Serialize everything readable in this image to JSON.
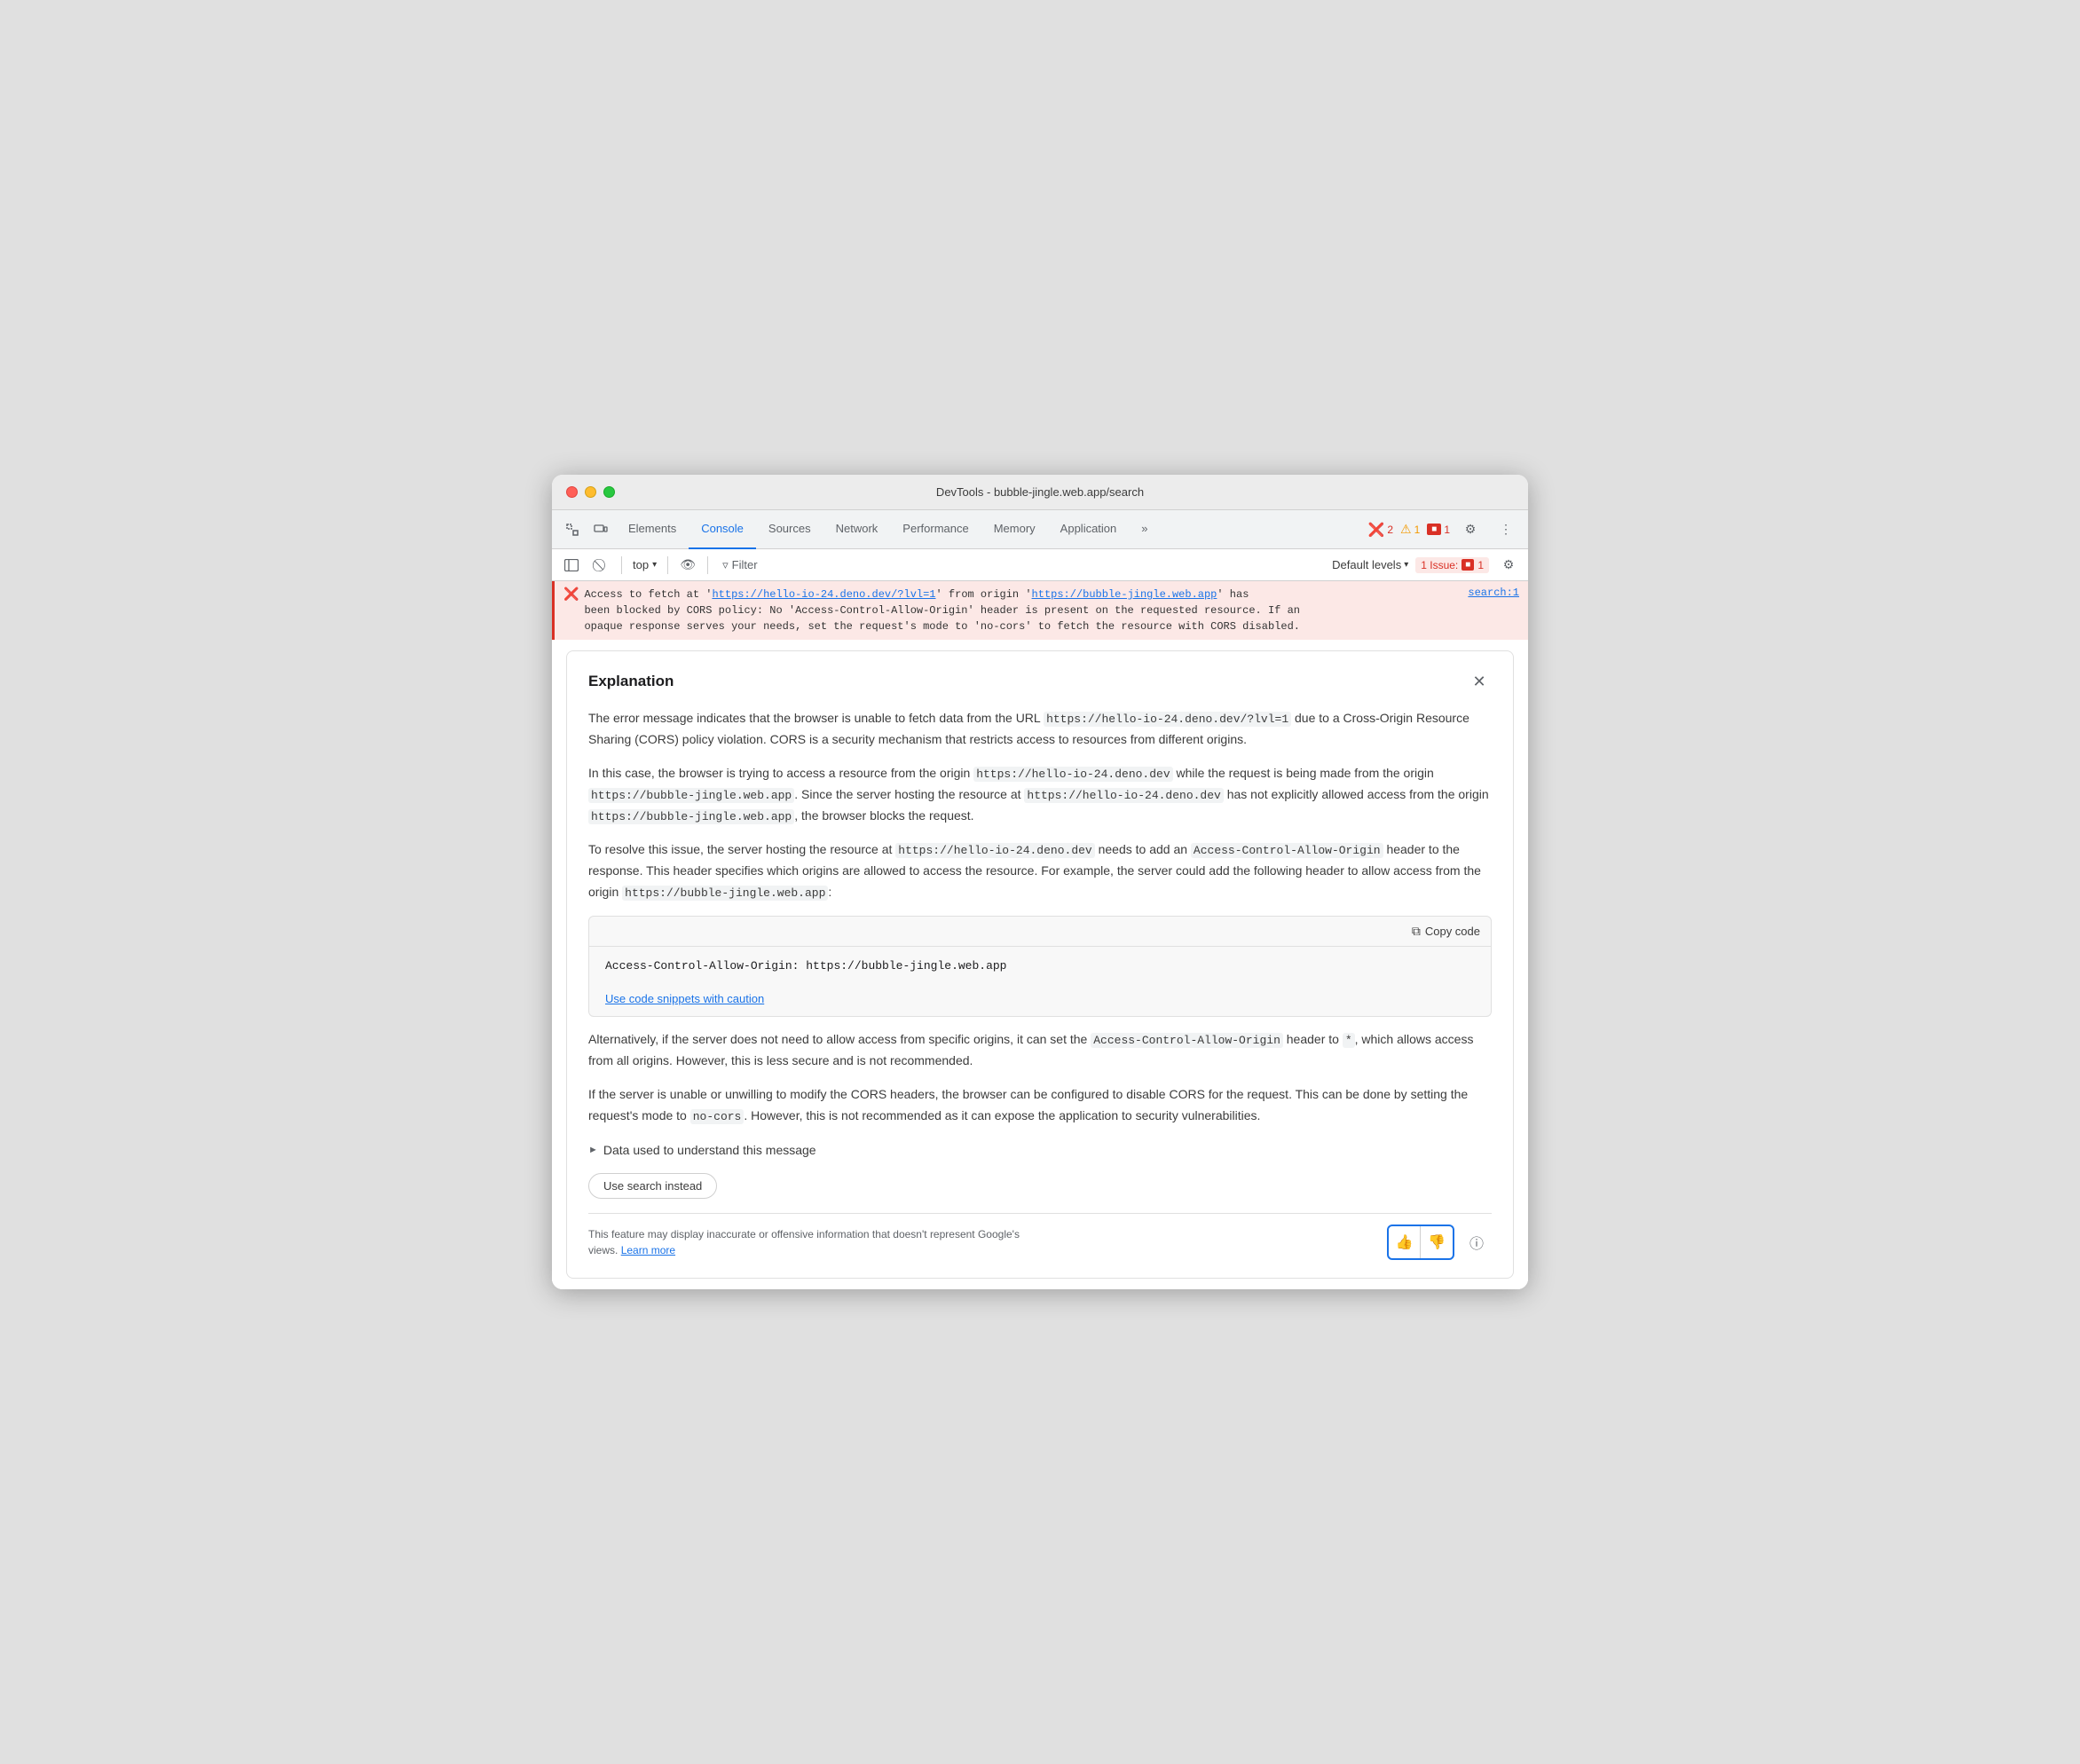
{
  "window": {
    "title": "DevTools - bubble-jingle.web.app/search"
  },
  "tabs": [
    {
      "label": "Elements",
      "active": false
    },
    {
      "label": "Console",
      "active": true
    },
    {
      "label": "Sources",
      "active": false
    },
    {
      "label": "Network",
      "active": false
    },
    {
      "label": "Performance",
      "active": false
    },
    {
      "label": "Memory",
      "active": false
    },
    {
      "label": "Application",
      "active": false
    }
  ],
  "badges": {
    "errors": "2",
    "warnings": "1",
    "issues": "1"
  },
  "toolbar": {
    "top_label": "top",
    "filter_label": "Filter",
    "default_levels_label": "Default levels",
    "issue_label": "1 Issue:",
    "issue_count": "1"
  },
  "error_message": {
    "prefix": "Access to fetch at '",
    "url1": "https://hello-io-24.deno.dev/?lvl=1",
    "mid1": "' from origin '",
    "url2": "https://bubble-jingle.web.app",
    "suffix": "' has been blocked by CORS policy: No 'Access-Control-Allow-Origin' header is present on the requested resource. If an opaque response serves your needs, set the request's mode to 'no-cors' to fetch the resource with CORS disabled.",
    "link": "search:1"
  },
  "explanation": {
    "title": "Explanation",
    "body1": "The error message indicates that the browser is unable to fetch data from the URL ",
    "url_inline1": "https://hello-io-24.deno.dev/?lvl=1",
    "body1b": " due to a Cross-Origin Resource Sharing (CORS) policy violation. CORS is a security mechanism that restricts access to resources from different origins.",
    "body2": "In this case, the browser is trying to access a resource from the origin ",
    "code1": "https://hello-io-24.deno.dev",
    "body2b": " while the request is being made from the origin ",
    "code2": "https://bubble-jingle.web.app",
    "body2c": ". Since the server hosting the resource at ",
    "code3": "https://hello-io-24.deno.dev",
    "body2d": " has not explicitly allowed access from the origin ",
    "code4": "https://bubble-jingle.web.app",
    "body2e": ", the browser blocks the request.",
    "body3": "To resolve this issue, the server hosting the resource at ",
    "code5": "https://hello-io-24.deno.dev",
    "body3b": " needs to add an ",
    "code6": "Access-Control-Allow-Origin",
    "body3c": " header to the response. This header specifies which origins are allowed to access the resource. For example, the server could add the following header to allow access from the origin ",
    "code7": "https://bubble-jingle.web.app",
    "body3d": ":",
    "code_snippet": "Access-Control-Allow-Origin: https://bubble-jingle.web.app",
    "caution_link": "Use code snippets with caution",
    "copy_code_label": "Copy code",
    "body4": "Alternatively, if the server does not need to allow access from specific origins, it can set the ",
    "code8": "Access-Control-Allow-Origin",
    "body4b": " header to ",
    "code9": "*",
    "body4c": ", which allows access from all origins. However, this is less secure and is not recommended.",
    "body5": "If the server is unable or unwilling to modify the CORS headers, the browser can be configured to disable CORS for the request. This can be done by setting the request's mode to ",
    "code10": "no-cors",
    "body5b": ". However, this is not recommended as it can expose the application to security vulnerabilities.",
    "data_used_label": "Data used to understand this message",
    "use_search_label": "Use search instead",
    "footer_text": "This feature may display inaccurate or offensive information that doesn't represent Google's views.",
    "learn_more": "Learn more"
  }
}
